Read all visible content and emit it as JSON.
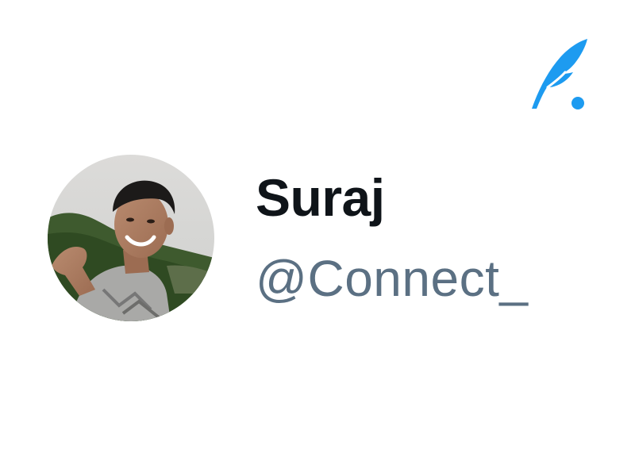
{
  "brand": {
    "logo_icon": "quill-feather-icon",
    "color": "#1d9bf0"
  },
  "profile": {
    "display_name": "Suraj",
    "handle": "@Connect_",
    "avatar_icon": "profile-photo"
  },
  "colors": {
    "name": "#0f1419",
    "handle": "#5b7083",
    "background": "#ffffff"
  }
}
